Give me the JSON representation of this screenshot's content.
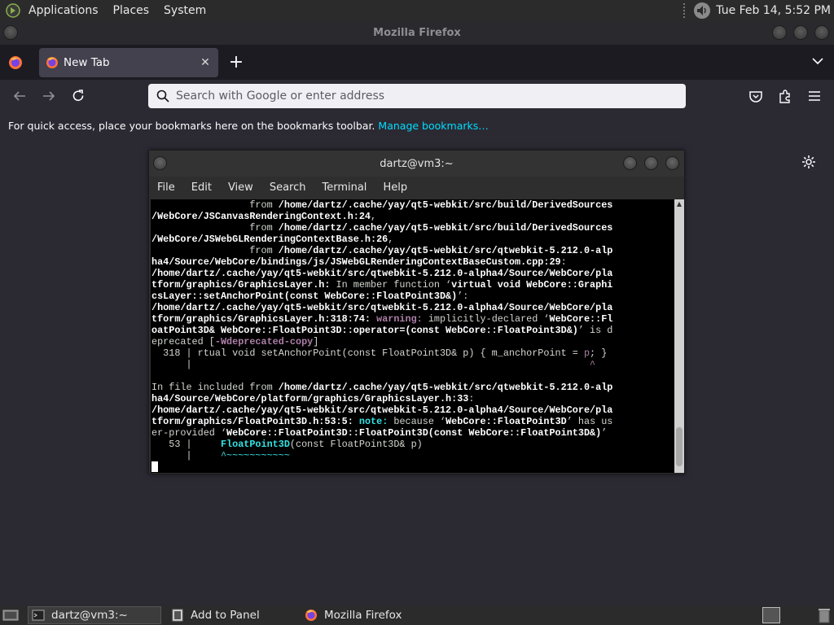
{
  "top_panel": {
    "menus": [
      "Applications",
      "Places",
      "System"
    ],
    "clock": "Tue Feb 14,  5:52 PM"
  },
  "firefox": {
    "window_title": "Mozilla Firefox",
    "tab": {
      "label": "New Tab",
      "close": "✕"
    },
    "new_tab": "+",
    "url_placeholder": "Search with Google or enter address",
    "bookmarks_text": "For quick access, place your bookmarks here on the bookmarks toolbar.",
    "bookmarks_link": "Manage bookmarks…"
  },
  "terminal": {
    "title": "dartz@vm3:~",
    "menu": [
      "File",
      "Edit",
      "View",
      "Search",
      "Terminal",
      "Help"
    ]
  },
  "taskbar": {
    "items": [
      "dartz@vm3:~",
      "Add to Panel",
      "Mozilla Firefox"
    ]
  },
  "colors": {
    "accent_link": "#00ddff",
    "warning": "#ad7fa8",
    "note": "#34e2e2"
  }
}
